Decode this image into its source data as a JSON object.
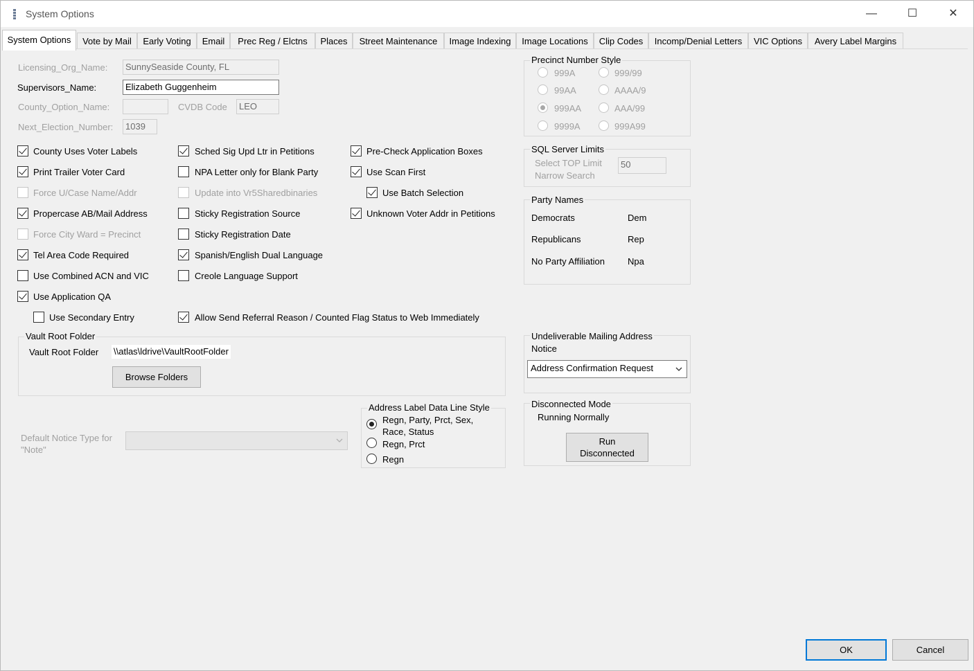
{
  "window": {
    "title": "System Options",
    "minimize": "—",
    "maximize": "☐",
    "close": "✕"
  },
  "tabs": [
    "System Options",
    "Vote by Mail",
    "Early Voting",
    "Email",
    "Prec Reg / Elctns",
    "Places",
    "Street Maintenance",
    "Image Indexing",
    "Image Locations",
    "Clip Codes",
    "Incomp/Denial Letters",
    "VIC Options",
    "Avery Label Margins"
  ],
  "fields": {
    "licensing_org_name": {
      "label": "Licensing_Org_Name:",
      "value": "SunnySeaside County, FL"
    },
    "supervisors_name": {
      "label": "Supervisors_Name:",
      "value": "Elizabeth Guggenheim"
    },
    "county_option_name": {
      "label": "County_Option_Name:",
      "value": ""
    },
    "cvdb_code": {
      "label": "CVDB Code",
      "value": "LEO"
    },
    "next_election_number": {
      "label": "Next_Election_Number:",
      "value": "1039"
    }
  },
  "checkboxes": {
    "county_uses_voter_labels": {
      "label": "County Uses Voter Labels",
      "checked": true
    },
    "print_trailer_voter_card": {
      "label": "Print Trailer Voter Card",
      "checked": true
    },
    "force_ucase": {
      "label": "Force U/Case Name/Addr",
      "checked": false
    },
    "propercase_ab": {
      "label": "Propercase AB/Mail Address",
      "checked": true
    },
    "force_city_ward": {
      "label": "Force City Ward = Precinct",
      "checked": false
    },
    "tel_area_code": {
      "label": "Tel Area Code Required",
      "checked": true
    },
    "use_combined_acn": {
      "label": "Use Combined ACN and VIC",
      "checked": false
    },
    "use_application_qa": {
      "label": "Use Application QA",
      "checked": true
    },
    "use_secondary_entry": {
      "label": "Use Secondary Entry",
      "checked": false
    },
    "sched_sig_upd": {
      "label": "Sched Sig Upd Ltr in Petitions",
      "checked": true
    },
    "npa_letter": {
      "label": "NPA Letter only for Blank Party",
      "checked": false
    },
    "update_vr5": {
      "label": "Update into Vr5Sharedbinaries",
      "checked": false
    },
    "sticky_reg_source": {
      "label": "Sticky Registration Source",
      "checked": false
    },
    "sticky_reg_date": {
      "label": "Sticky Registration Date",
      "checked": false
    },
    "spanish_english": {
      "label": "Spanish/English Dual Language",
      "checked": true
    },
    "creole_support": {
      "label": "Creole Language Support",
      "checked": false
    },
    "allow_send_referral": {
      "label": "Allow Send Referral Reason / Counted Flag Status to Web Immediately",
      "checked": true
    },
    "precheck_app_boxes": {
      "label": "Pre-Check Application Boxes",
      "checked": true
    },
    "use_scan_first": {
      "label": "Use Scan First",
      "checked": true
    },
    "use_batch_selection": {
      "label": "Use Batch Selection",
      "checked": true
    },
    "unknown_voter_addr": {
      "label": "Unknown Voter Addr in Petitions",
      "checked": true
    }
  },
  "vault": {
    "group": "Vault Root Folder",
    "label": "Vault Root Folder",
    "path": "\\\\atlas\\ldrive\\VaultRootFolder",
    "browse": "Browse Folders"
  },
  "default_notice": {
    "label1": "Default Notice Type for",
    "label2": "\"Note\"",
    "value": ""
  },
  "address_label": {
    "group": "Address Label Data Line Style",
    "opt1a": "Regn, Party, Prct, Sex,",
    "opt1b": "Race, Status",
    "opt2": "Regn, Prct",
    "opt3": "Regn"
  },
  "precinct_style": {
    "group": "Precinct Number Style",
    "options": [
      "999A",
      "999/99",
      "99AA",
      "AAAA/9",
      "999AA",
      "AAA/99",
      "9999A",
      "999A99"
    ],
    "selected": "999AA"
  },
  "sql_limits": {
    "group": "SQL Server Limits",
    "label1": "Select TOP Limit",
    "label2": "Narrow Search",
    "value": "50"
  },
  "party_names": {
    "group": "Party Names",
    "rows": [
      {
        "name": "Democrats",
        "code": "Dem"
      },
      {
        "name": "Republicans",
        "code": "Rep"
      },
      {
        "name": "No Party Affiliation",
        "code": "Npa"
      }
    ]
  },
  "undeliverable": {
    "group1": "Undeliverable Mailing Address",
    "group2": "Notice",
    "value": "Address Confirmation Request"
  },
  "disconnected": {
    "group": "Disconnected Mode",
    "status": "Running Normally",
    "btn1": "Run",
    "btn2": "Disconnected"
  },
  "footer": {
    "ok": "OK",
    "cancel": "Cancel"
  }
}
